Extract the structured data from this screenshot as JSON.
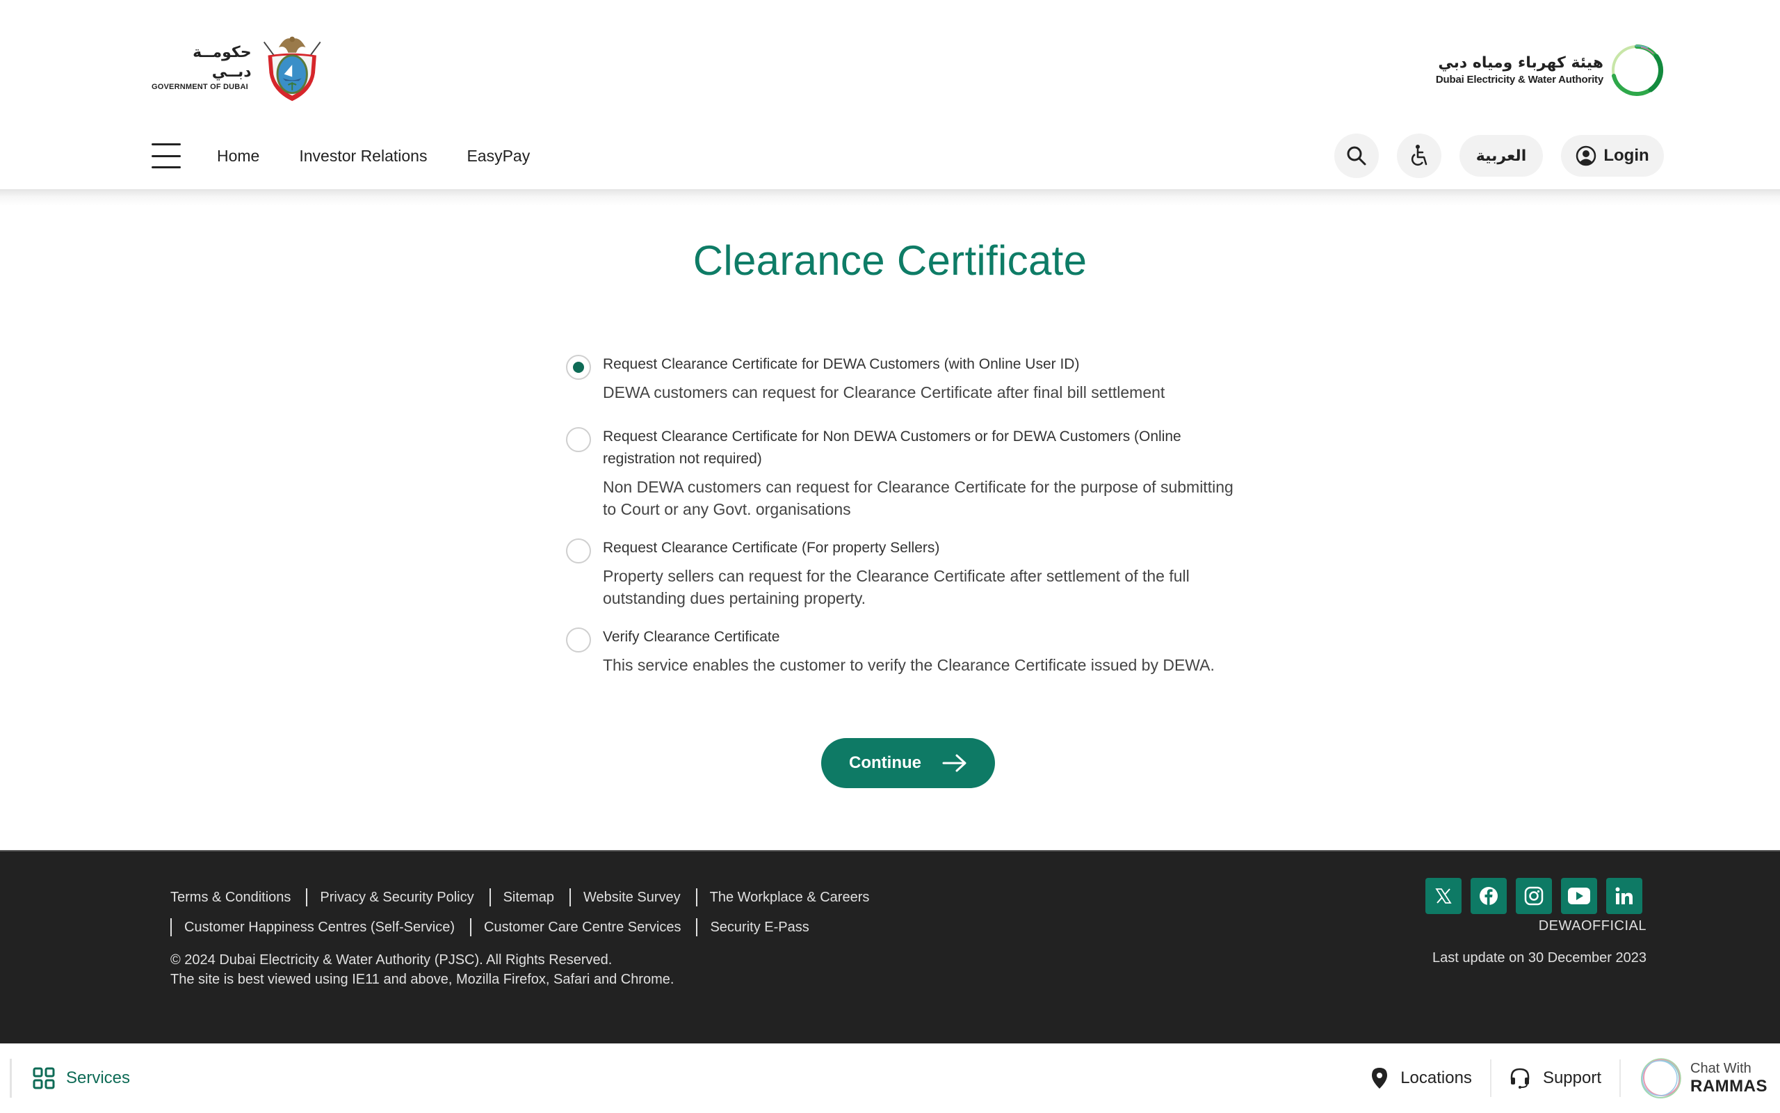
{
  "header": {
    "gov_logo": {
      "arabic": "حكومــة دبــي",
      "english": "GOVERNMENT OF DUBAI"
    },
    "dewa_logo": {
      "arabic": "هيئة كهرباء ومياه دبي",
      "english": "Dubai Electricity & Water Authority"
    },
    "nav": [
      {
        "label": "Home"
      },
      {
        "label": "Investor Relations"
      },
      {
        "label": "EasyPay"
      }
    ],
    "actions": {
      "search_icon": "search-icon",
      "accessibility_icon": "wheelchair-icon",
      "language_label": "العربية",
      "login_label": "Login"
    }
  },
  "main": {
    "title": "Clearance Certificate",
    "selected_option": 0,
    "options": [
      {
        "label": "Request Clearance Certificate for DEWA Customers (with Online User ID)",
        "description": "DEWA customers can request for Clearance Certificate after final bill settlement",
        "checked": true
      },
      {
        "label": "Request Clearance Certificate for Non DEWA Customers or for DEWA Customers (Online registration not required)",
        "description": "Non DEWA customers can request for Clearance Certificate for the purpose of submitting to Court or any Govt. organisations",
        "checked": false
      },
      {
        "label": "Request Clearance Certificate (For property Sellers)",
        "description": "Property sellers can request for the Clearance Certificate after settlement of the full outstanding dues pertaining property.",
        "checked": false
      },
      {
        "label": "Verify Clearance Certificate",
        "description": "This service enables the customer to verify the Clearance Certificate issued by DEWA.",
        "checked": false
      }
    ],
    "continue_label": "Continue"
  },
  "footer": {
    "links_row1": [
      "Terms & Conditions",
      "Privacy & Security Policy",
      "Sitemap",
      "Website Survey",
      "The Workplace & Careers"
    ],
    "links_row2": [
      "Customer Happiness Centres (Self-Service)",
      "Customer Care Centre Services",
      "Security E-Pass"
    ],
    "copyright": "© 2024 Dubai Electricity & Water Authority (PJSC). All Rights Reserved.",
    "browser_note": "The site is best viewed using IE11 and above, Mozilla Firefox, Safari and Chrome.",
    "social": [
      "x",
      "facebook",
      "instagram",
      "youtube",
      "linkedin"
    ],
    "social_handle": "DEWAOFFICIAL",
    "last_update": "Last update on 30 December 2023"
  },
  "bottom_bar": {
    "services_label": "Services",
    "locations_label": "Locations",
    "support_label": "Support",
    "chat_small": "Chat With",
    "chat_big": "RAMMAS"
  },
  "colors": {
    "brand_green": "#0e7a65",
    "title_green": "#0e7c66",
    "footer_bg": "#222222"
  }
}
